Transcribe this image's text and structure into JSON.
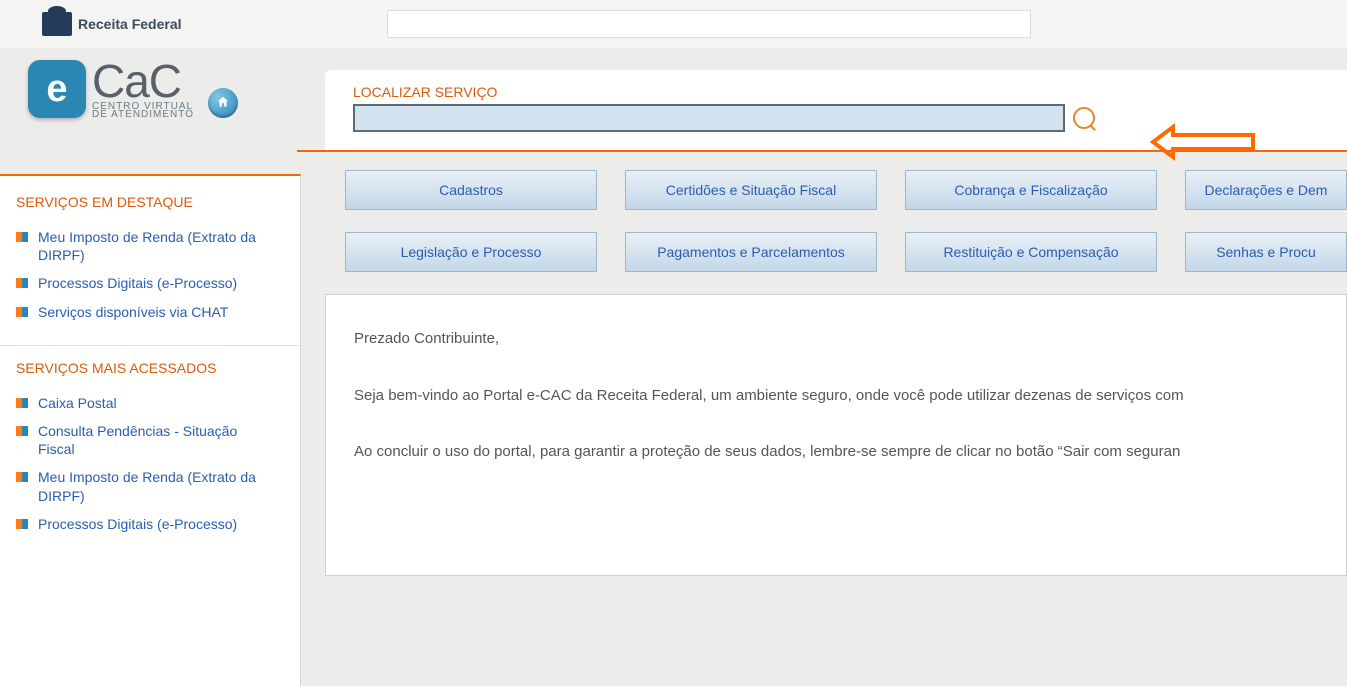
{
  "header": {
    "org": "Receita Federal",
    "logo": {
      "cac": "CaC",
      "sub1": "CENTRO VIRTUAL",
      "sub2": "DE ATENDIMENTO"
    }
  },
  "search": {
    "label": "LOCALIZAR SERVIÇO",
    "value": ""
  },
  "categories_row1": [
    "Cadastros",
    "Certidões e Situação Fiscal",
    "Cobrança e Fiscalização",
    "Declarações e Dem"
  ],
  "categories_row2": [
    "Legislação e Processo",
    "Pagamentos e Parcelamentos",
    "Restituição e Compensação",
    "Senhas e Procu"
  ],
  "sidebar": {
    "destaque_title": "SERVIÇOS EM DESTAQUE",
    "destaque": [
      "Meu Imposto de Renda (Extrato da DIRPF)",
      "Processos Digitais (e-Processo)",
      "Serviços disponíveis via CHAT"
    ],
    "acessados_title": "SERVIÇOS MAIS ACESSADOS",
    "acessados": [
      "Caixa Postal",
      "Consulta Pendências - Situação Fiscal",
      "Meu Imposto de Renda (Extrato da DIRPF)",
      "Processos Digitais (e-Processo)"
    ]
  },
  "content": {
    "p1": "Prezado Contribuinte,",
    "p2": "Seja bem-vindo ao Portal e-CAC da Receita Federal, um ambiente seguro, onde você pode utilizar dezenas de serviços com",
    "p3": "Ao concluir o uso do portal, para garantir a proteção de seus dados, lembre-se sempre de clicar no botão “Sair com seguran"
  }
}
